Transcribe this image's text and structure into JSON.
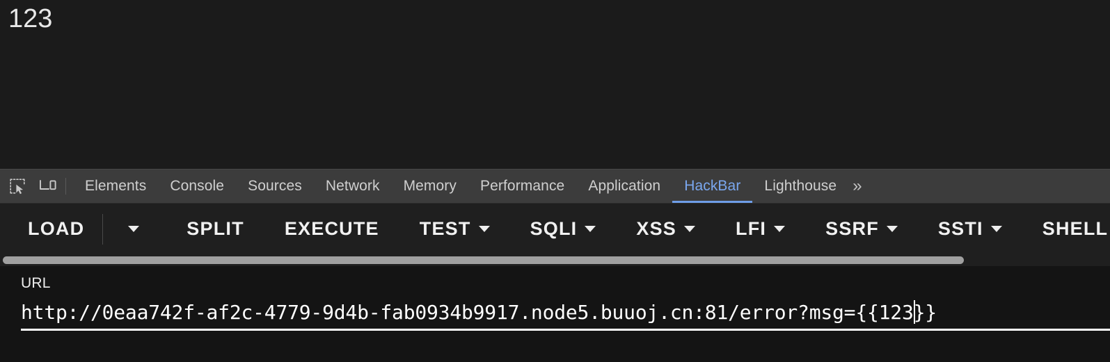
{
  "page": {
    "body_text": "123"
  },
  "devtools": {
    "left_icons": [
      {
        "name": "inspect-element-icon",
        "label": "Inspect element"
      },
      {
        "name": "device-toolbar-icon",
        "label": "Toggle device toolbar"
      }
    ],
    "tabs": [
      {
        "label": "Elements",
        "active": false
      },
      {
        "label": "Console",
        "active": false
      },
      {
        "label": "Sources",
        "active": false
      },
      {
        "label": "Network",
        "active": false
      },
      {
        "label": "Memory",
        "active": false
      },
      {
        "label": "Performance",
        "active": false
      },
      {
        "label": "Application",
        "active": false
      },
      {
        "label": "HackBar",
        "active": true
      },
      {
        "label": "Lighthouse",
        "active": false
      }
    ],
    "more_tabs_label": "»",
    "active_tab": "HackBar",
    "accent_color": "#6f9ee8",
    "tabstrip_bg": "#3c3c3c"
  },
  "hackbar": {
    "buttons": [
      {
        "label": "LOAD",
        "has_caret": false,
        "split_caret": true
      },
      {
        "label": "SPLIT",
        "has_caret": false,
        "split_caret": false
      },
      {
        "label": "EXECUTE",
        "has_caret": false,
        "split_caret": false
      },
      {
        "label": "TEST",
        "has_caret": true,
        "split_caret": false
      },
      {
        "label": "SQLI",
        "has_caret": true,
        "split_caret": false
      },
      {
        "label": "XSS",
        "has_caret": true,
        "split_caret": false
      },
      {
        "label": "LFI",
        "has_caret": true,
        "split_caret": false
      },
      {
        "label": "SSRF",
        "has_caret": true,
        "split_caret": false
      },
      {
        "label": "SSTI",
        "has_caret": true,
        "split_caret": false
      },
      {
        "label": "SHELL",
        "has_caret": true,
        "split_caret": false
      }
    ],
    "url": {
      "label": "URL",
      "value": "http://0eaa742f-af2c-4779-9d4b-fab0934b9917.node5.buuoj.cn:81/error?msg={{123}}",
      "placeholder": "",
      "caret_after": "http://0eaa742f-af2c-4779-9d4b-fab0934b9917.node5.buuoj.cn:81/error?msg={{123",
      "focused": true
    }
  }
}
